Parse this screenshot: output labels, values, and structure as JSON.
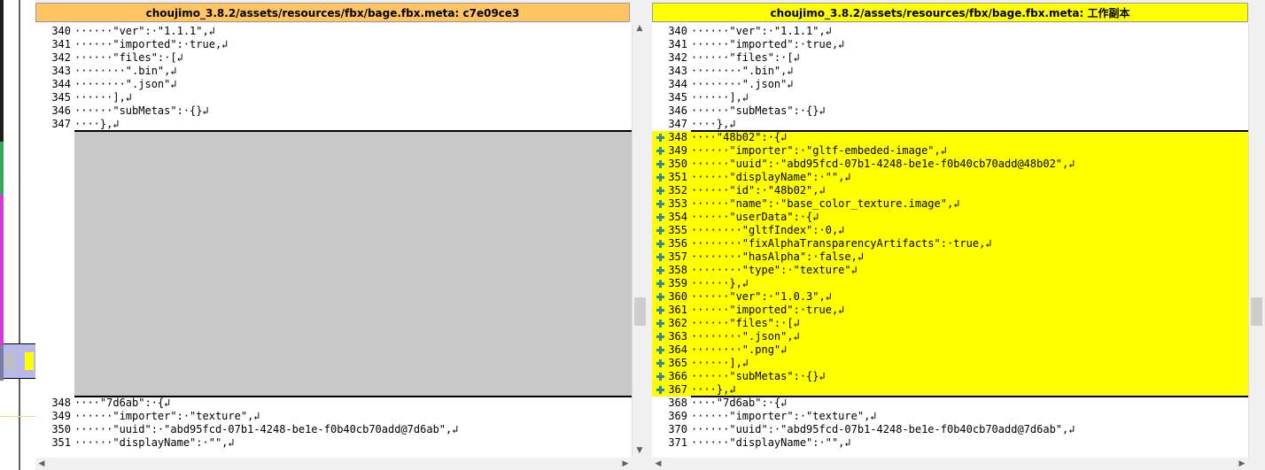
{
  "colors": {
    "left_header_bg": "#ffc562",
    "right_header_bg": "#ffff00",
    "added_line_bg": "#ffff00",
    "gap_bg": "#c8c8c8",
    "added_marker": "#2e8b9a"
  },
  "left_pane": {
    "title": "choujimo_3.8.2/assets/resources/fbx/bage.fbx.meta: c7e09ce3",
    "lines_top": [
      {
        "n": "340",
        "t": "······\"ver\":·\"1.1.1\",↲"
      },
      {
        "n": "341",
        "t": "······\"imported\":·true,↲"
      },
      {
        "n": "342",
        "t": "······\"files\":·[↲"
      },
      {
        "n": "343",
        "t": "········\".bin\",↲"
      },
      {
        "n": "344",
        "t": "········\".json\"↲"
      },
      {
        "n": "345",
        "t": "······],↲"
      },
      {
        "n": "346",
        "t": "······\"subMetas\":·{}↲"
      },
      {
        "n": "347",
        "t": "····},↲"
      }
    ],
    "lines_bottom": [
      {
        "n": "348",
        "t": "····\"7d6ab\":·{↲"
      },
      {
        "n": "349",
        "t": "······\"importer\":·\"texture\",↲"
      },
      {
        "n": "350",
        "t": "······\"uuid\":·\"abd95fcd-07b1-4248-be1e-f0b40cb70add@7d6ab\",↲"
      },
      {
        "n": "351",
        "t": "······\"displayName\":·\"\",↲"
      }
    ]
  },
  "right_pane": {
    "title": "choujimo_3.8.2/assets/resources/fbx/bage.fbx.meta: 工作副本",
    "lines": [
      {
        "n": "340",
        "t": "······\"ver\":·\"1.1.1\",↲",
        "added": false
      },
      {
        "n": "341",
        "t": "······\"imported\":·true,↲",
        "added": false
      },
      {
        "n": "342",
        "t": "······\"files\":·[↲",
        "added": false
      },
      {
        "n": "343",
        "t": "········\".bin\",↲",
        "added": false
      },
      {
        "n": "344",
        "t": "········\".json\"↲",
        "added": false
      },
      {
        "n": "345",
        "t": "······],↲",
        "added": false
      },
      {
        "n": "346",
        "t": "······\"subMetas\":·{}↲",
        "added": false
      },
      {
        "n": "347",
        "t": "····},↲",
        "added": false
      },
      {
        "n": "348",
        "t": "····\"48b02\":·{↲",
        "added": true
      },
      {
        "n": "349",
        "t": "······\"importer\":·\"gltf-embeded-image\",↲",
        "added": true
      },
      {
        "n": "350",
        "t": "······\"uuid\":·\"abd95fcd-07b1-4248-be1e-f0b40cb70add@48b02\",↲",
        "added": true
      },
      {
        "n": "351",
        "t": "······\"displayName\":·\"\",↲",
        "added": true
      },
      {
        "n": "352",
        "t": "······\"id\":·\"48b02\",↲",
        "added": true
      },
      {
        "n": "353",
        "t": "······\"name\":·\"base_color_texture.image\",↲",
        "added": true
      },
      {
        "n": "354",
        "t": "······\"userData\":·{↲",
        "added": true
      },
      {
        "n": "355",
        "t": "········\"gltfIndex\":·0,↲",
        "added": true
      },
      {
        "n": "356",
        "t": "········\"fixAlphaTransparencyArtifacts\":·true,↲",
        "added": true
      },
      {
        "n": "357",
        "t": "········\"hasAlpha\":·false,↲",
        "added": true
      },
      {
        "n": "358",
        "t": "········\"type\":·\"texture\"↲",
        "added": true
      },
      {
        "n": "359",
        "t": "······},↲",
        "added": true
      },
      {
        "n": "360",
        "t": "······\"ver\":·\"1.0.3\",↲",
        "added": true
      },
      {
        "n": "361",
        "t": "······\"imported\":·true,↲",
        "added": true
      },
      {
        "n": "362",
        "t": "······\"files\":·[↲",
        "added": true
      },
      {
        "n": "363",
        "t": "········\".json\",↲",
        "added": true
      },
      {
        "n": "364",
        "t": "········\".png\"↲",
        "added": true
      },
      {
        "n": "365",
        "t": "······],↲",
        "added": true
      },
      {
        "n": "366",
        "t": "······\"subMetas\":·{}↲",
        "added": true
      },
      {
        "n": "367",
        "t": "····},↲",
        "added": true
      },
      {
        "n": "368",
        "t": "····\"7d6ab\":·{↲",
        "added": false
      },
      {
        "n": "369",
        "t": "······\"importer\":·\"texture\",↲",
        "added": false
      },
      {
        "n": "370",
        "t": "······\"uuid\":·\"abd95fcd-07b1-4248-be1e-f0b40cb70add@7d6ab\",↲",
        "added": false
      },
      {
        "n": "371",
        "t": "······\"displayName\":·\"\",↲",
        "added": false
      }
    ]
  },
  "icons": {
    "added_marker": "plus-icon",
    "scroll_up": "arrow-up-icon",
    "scroll_down": "arrow-down-icon",
    "scroll_left": "arrow-left-icon",
    "scroll_right": "arrow-right-icon"
  }
}
